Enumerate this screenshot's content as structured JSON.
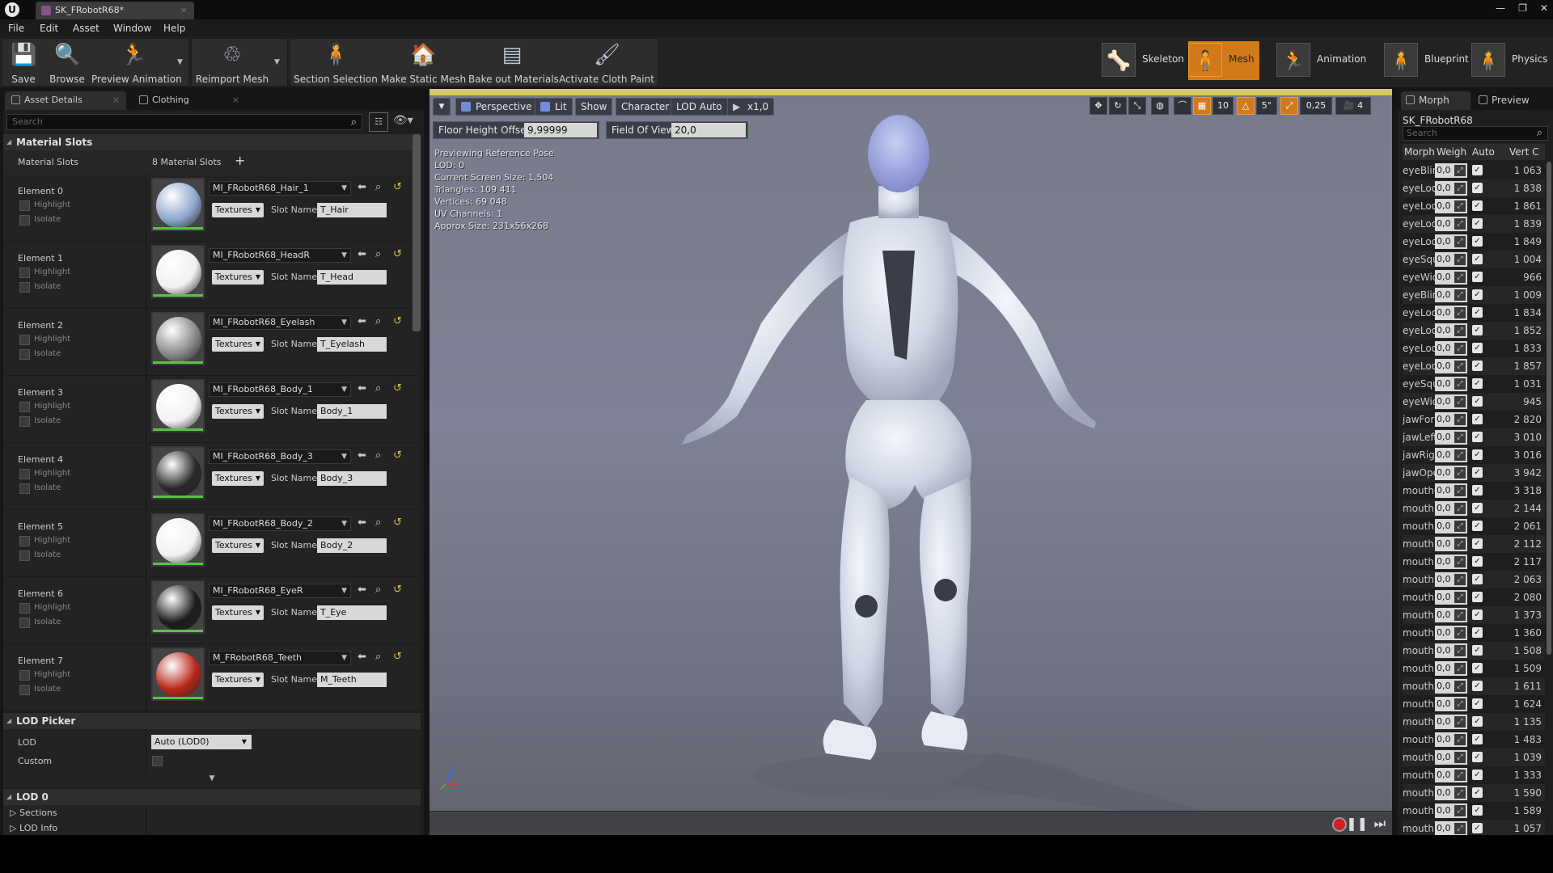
{
  "app": {
    "doc_tab": "SK_FRobotR68*"
  },
  "menu": [
    "File",
    "Edit",
    "Asset",
    "Window",
    "Help"
  ],
  "toolbar": {
    "buttons": [
      {
        "label": "Save",
        "icon": "save-icon"
      },
      {
        "label": "Browse",
        "icon": "browse-icon"
      },
      {
        "label": "Preview Animation",
        "icon": "preview-animation-icon"
      },
      {
        "label": "Reimport Mesh",
        "icon": "reimport-icon"
      },
      {
        "label": "Section Selection",
        "icon": "section-selection-icon"
      },
      {
        "label": "Make Static Mesh",
        "icon": "make-static-mesh-icon"
      },
      {
        "label": "Bake out Materials",
        "icon": "bake-materials-icon"
      },
      {
        "label": "Activate Cloth Paint",
        "icon": "cloth-paint-icon"
      }
    ],
    "modes": [
      {
        "label": "Skeleton",
        "active": false
      },
      {
        "label": "Mesh",
        "active": true
      },
      {
        "label": "Animation",
        "active": false
      },
      {
        "label": "Blueprint",
        "active": false
      },
      {
        "label": "Physics",
        "active": false
      }
    ]
  },
  "left": {
    "tabs": [
      "Asset Details",
      "Clothing"
    ],
    "search_placeholder": "Search",
    "material_slots_category": "Material Slots",
    "material_slots_label": "Material Slots",
    "material_slots_count": "8 Material Slots",
    "highlight": "Highlight",
    "isolate": "Isolate",
    "textures": "Textures",
    "slot_name_label": "Slot Name",
    "elements": [
      {
        "name": "Element 0",
        "material": "MI_FRobotR68_Hair_1",
        "slot": "T_Hair",
        "color": "#8ea7cc"
      },
      {
        "name": "Element 1",
        "material": "MI_FRobotR68_HeadR",
        "slot": "T_Head",
        "color": "#f0f0f2"
      },
      {
        "name": "Element 2",
        "material": "MI_FRobotR68_Eyelash",
        "slot": "T_Eyelash",
        "color": "#8a8a8a"
      },
      {
        "name": "Element 3",
        "material": "MI_FRobotR68_Body_1",
        "slot": "Body_1",
        "color": "#f2f2f2"
      },
      {
        "name": "Element 4",
        "material": "MI_FRobotR68_Body_3",
        "slot": "Body_3",
        "color": "#2a2a2a"
      },
      {
        "name": "Element 5",
        "material": "MI_FRobotR68_Body_2",
        "slot": "Body_2",
        "color": "#f2f2f2"
      },
      {
        "name": "Element 6",
        "material": "MI_FRobotR68_EyeR",
        "slot": "T_Eye",
        "color": "#1c1c1c"
      },
      {
        "name": "Element 7",
        "material": "M_FRobotR68_Teeth",
        "slot": "M_Teeth",
        "color": "#b8261a"
      }
    ],
    "lod_picker": "LOD Picker",
    "lod_label": "LOD",
    "lod_value": "Auto (LOD0)",
    "custom_label": "Custom",
    "lod0": "LOD 0",
    "sections": "Sections",
    "lod_info": "LOD Info"
  },
  "viewport": {
    "tools": [
      "Perspective",
      "Lit",
      "Show",
      "Character",
      "LOD Auto",
      "x1,0"
    ],
    "floor_label": "Floor Height Offset",
    "floor_value": "9,99999",
    "fov_label": "Field Of View",
    "fov_value": "20,0",
    "icons": {
      "grid": "10",
      "angle": "5°",
      "scale": "0,25",
      "camera": "4"
    },
    "info": [
      "Previewing Reference Pose",
      "LOD: 0",
      "Current Screen Size: 1,504",
      "Triangles: 109 411",
      "Vertices: 69 048",
      "UV Channels: 1",
      "Approx Size: 231x56x268"
    ]
  },
  "right": {
    "tabs": [
      "Morph",
      "Preview"
    ],
    "mesh_name": "SK_FRobotR68",
    "search_placeholder": "Search",
    "headers": [
      "Morph",
      "Weigh",
      "Auto",
      "Vert C"
    ],
    "rows": [
      [
        "eyeBlin",
        "0,0",
        "1 063"
      ],
      [
        "eyeLoo",
        "0,0",
        "1 838"
      ],
      [
        "eyeLoo",
        "0,0",
        "1 861"
      ],
      [
        "eyeLoo",
        "0,0",
        "1 839"
      ],
      [
        "eyeLoo",
        "0,0",
        "1 849"
      ],
      [
        "eyeSqu",
        "0,0",
        "1 004"
      ],
      [
        "eyeWid",
        "0,0",
        "966"
      ],
      [
        "eyeBlin",
        "0,0",
        "1 009"
      ],
      [
        "eyeLoo",
        "0,0",
        "1 834"
      ],
      [
        "eyeLoo",
        "0,0",
        "1 852"
      ],
      [
        "eyeLoo",
        "0,0",
        "1 833"
      ],
      [
        "eyeLoo",
        "0,0",
        "1 857"
      ],
      [
        "eyeSqu",
        "0,0",
        "1 031"
      ],
      [
        "eyeWid",
        "0,0",
        "945"
      ],
      [
        "jawFor",
        "0,0",
        "2 820"
      ],
      [
        "jawLeft",
        "0,0",
        "3 010"
      ],
      [
        "jawRigl",
        "0,0",
        "3 016"
      ],
      [
        "jawOpe",
        "0,0",
        "3 942"
      ],
      [
        "mouthC",
        "0,0",
        "3 318"
      ],
      [
        "mouthF",
        "0,0",
        "2 144"
      ],
      [
        "mouthF",
        "0,0",
        "2 061"
      ],
      [
        "mouthF",
        "0,0",
        "2 112"
      ],
      [
        "mouthL",
        "0,0",
        "2 117"
      ],
      [
        "mouthS",
        "0,0",
        "2 063"
      ],
      [
        "mouthS",
        "0,0",
        "2 080"
      ],
      [
        "mouthF",
        "0,0",
        "1 373"
      ],
      [
        "mouthF",
        "0,0",
        "1 360"
      ],
      [
        "mouthD",
        "0,0",
        "1 508"
      ],
      [
        "mouthD",
        "0,0",
        "1 509"
      ],
      [
        "mouthS",
        "0,0",
        "1 611"
      ],
      [
        "mouthS",
        "0,0",
        "1 624"
      ],
      [
        "mouthF",
        "0,0",
        "1 135"
      ],
      [
        "mouthF",
        "0,0",
        "1 483"
      ],
      [
        "mouthS",
        "0,0",
        "1 039"
      ],
      [
        "mouthS",
        "0,0",
        "1 333"
      ],
      [
        "mouthF",
        "0,0",
        "1 590"
      ],
      [
        "mouthF",
        "0,0",
        "1 589"
      ],
      [
        "mouthL",
        "0,0",
        "1 057"
      ]
    ]
  }
}
